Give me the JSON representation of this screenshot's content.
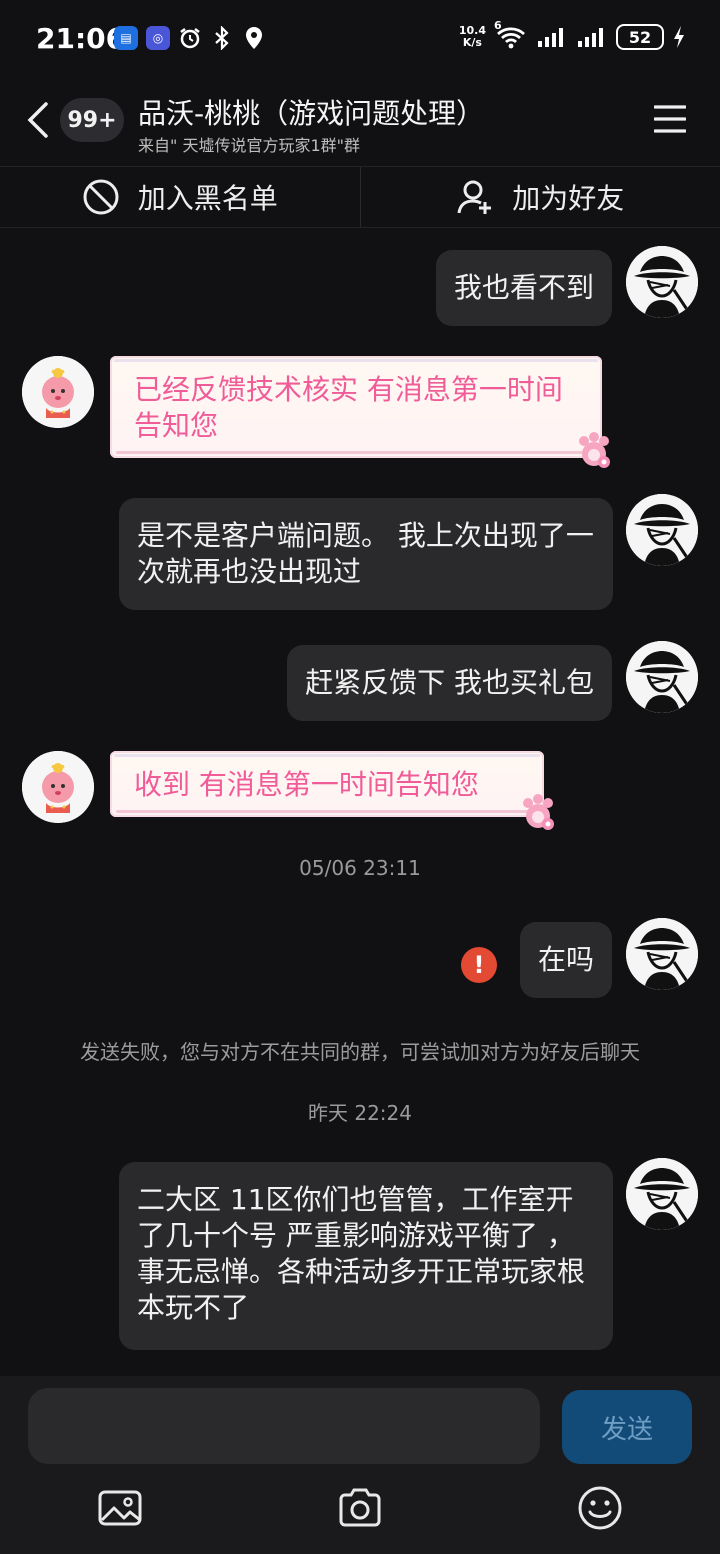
{
  "status_bar": {
    "time": "21:06",
    "net_speed_top": "10.4",
    "net_speed_unit": "K/s",
    "wifi_gen": "6",
    "battery": "52"
  },
  "header": {
    "badge": "99+",
    "title": "品沃-桃桃（游戏问题处理）",
    "subtitle": "来自\" 天墟传说官方玩家1群\"群"
  },
  "actions": {
    "block": "加入黑名单",
    "add_friend": "加为好友"
  },
  "messages": [
    {
      "side": "right",
      "text": "我也看不到"
    },
    {
      "side": "left",
      "text": "已经反馈技术核实 有消息第一时间告知您"
    },
    {
      "side": "right",
      "text": "是不是客户端问题。 我上次出现了一次就再也没出现过"
    },
    {
      "side": "right",
      "text": "赶紧反馈下  我也买礼包"
    },
    {
      "side": "left",
      "text": "收到  有消息第一时间告知您"
    },
    {
      "side": "right",
      "text": "在吗"
    },
    {
      "side": "right",
      "text": "二大区 11区你们也管管，工作室开了几十个号 严重影响游戏平衡了  ，事无忌惮。各种活动多开正常玩家根本玩不了"
    }
  ],
  "timestamps": [
    "05/06 23:11",
    "昨天 22:24"
  ],
  "system_note": "发送失败，您与对方不在共同的群，可尝试加对方为好友后聊天",
  "error_mark": "!",
  "composer": {
    "input_placeholder": "",
    "send_label": "发送"
  },
  "colors": {
    "background": "#111113",
    "bubble": "#2a2a2d",
    "pink_text": "#ef5c98",
    "send_button": "#124b78",
    "error": "#e34a33"
  }
}
